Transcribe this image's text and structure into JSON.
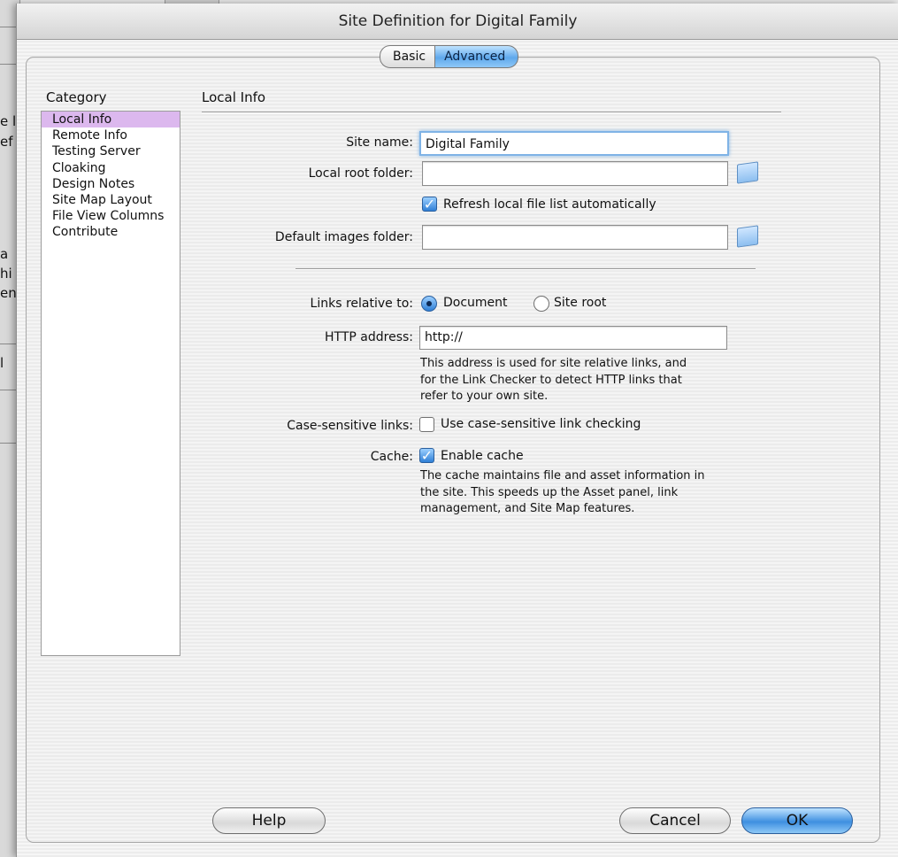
{
  "background": {
    "fragments": [
      "e l",
      "ef",
      "a",
      "hi",
      "en",
      "l"
    ]
  },
  "dialog": {
    "title": "Site Definition for Digital Family",
    "tabs": [
      "Basic",
      "Advanced"
    ],
    "active_tab": "Advanced",
    "category_heading": "Category",
    "categories": [
      "Local Info",
      "Remote Info",
      "Testing Server",
      "Cloaking",
      "Design Notes",
      "Site Map Layout",
      "File View Columns",
      "Contribute"
    ],
    "selected_category": "Local Info",
    "section_title": "Local Info",
    "site_name": {
      "label": "Site name:",
      "value": "Digital Family"
    },
    "local_root": {
      "label": "Local root folder:",
      "value": ""
    },
    "refresh": {
      "label": "Refresh local file list automatically",
      "checked": true
    },
    "default_images": {
      "label": "Default images folder:",
      "value": ""
    },
    "links_relative": {
      "label": "Links relative to:",
      "options": [
        "Document",
        "Site root"
      ],
      "selected": "Document"
    },
    "http_address": {
      "label": "HTTP address:",
      "value": "http://",
      "help": [
        "This address is used for site relative links, and",
        "for the Link Checker to detect HTTP links that",
        "refer to your own site."
      ]
    },
    "case_sensitive": {
      "label": "Case-sensitive links:",
      "option": "Use case-sensitive link checking",
      "checked": false
    },
    "cache": {
      "label": "Cache:",
      "option": "Enable cache",
      "checked": true,
      "help": [
        "The cache maintains file and asset information in",
        "the site.  This speeds up the Asset panel, link",
        "management, and Site Map features."
      ]
    },
    "buttons": {
      "help": "Help",
      "cancel": "Cancel",
      "ok": "OK"
    },
    "colors": {
      "accent": "#5fa8ec",
      "selection": "#dcb8ee"
    }
  }
}
